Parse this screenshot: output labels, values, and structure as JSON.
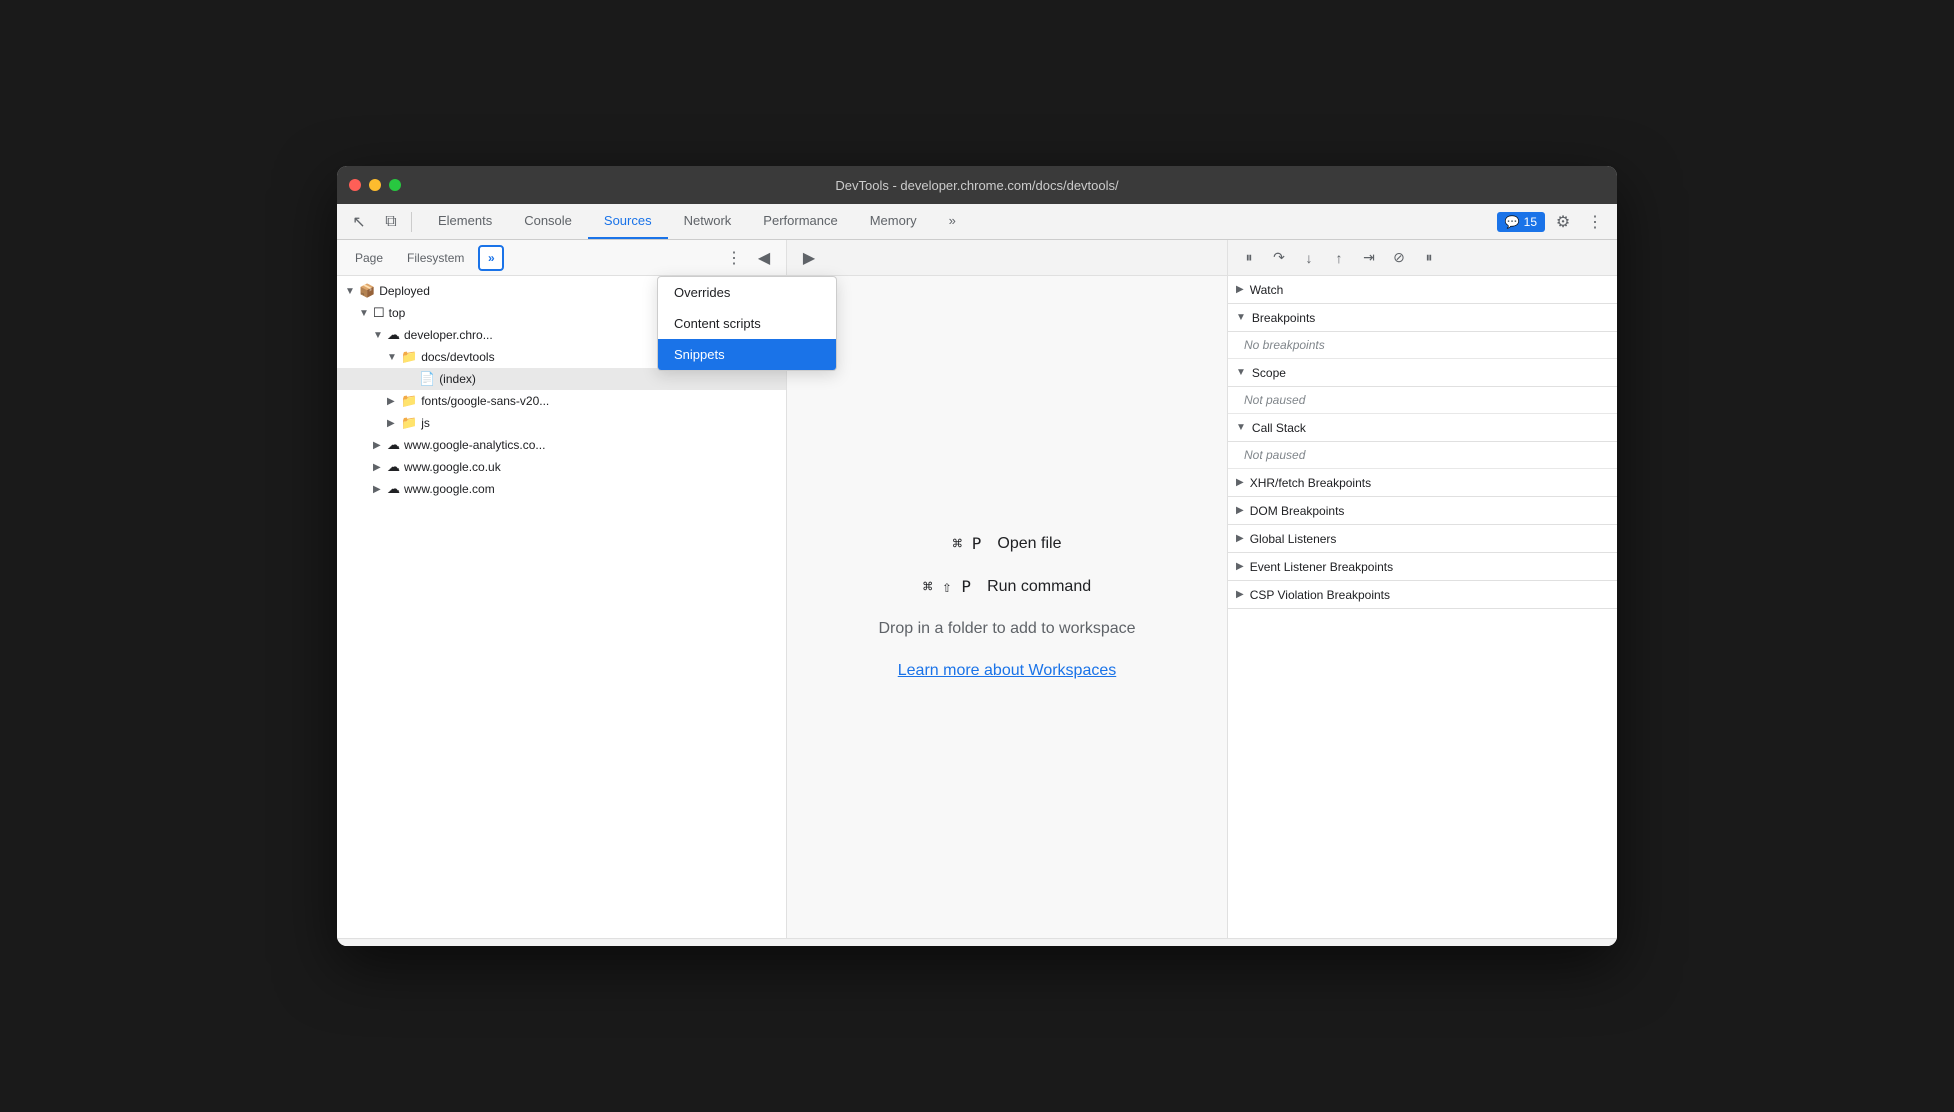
{
  "titlebar": {
    "title": "DevTools - developer.chrome.com/docs/devtools/"
  },
  "toolbar": {
    "tabs": [
      {
        "id": "elements",
        "label": "Elements",
        "active": false
      },
      {
        "id": "console",
        "label": "Console",
        "active": false
      },
      {
        "id": "sources",
        "label": "Sources",
        "active": true
      },
      {
        "id": "network",
        "label": "Network",
        "active": false
      },
      {
        "id": "performance",
        "label": "Performance",
        "active": false
      },
      {
        "id": "memory",
        "label": "Memory",
        "active": false
      }
    ],
    "badge": {
      "icon": "💬",
      "count": "15"
    },
    "more_tabs_label": "»"
  },
  "sources_panel": {
    "tabs": [
      {
        "id": "page",
        "label": "Page"
      },
      {
        "id": "filesystem",
        "label": "Filesystem"
      }
    ],
    "more_btn": "»",
    "file_tree": [
      {
        "level": 0,
        "indent": 0,
        "icon": "📦",
        "label": "Deployed",
        "expanded": true,
        "type": "folder"
      },
      {
        "level": 1,
        "indent": 1,
        "icon": "☐",
        "label": "top",
        "expanded": true,
        "type": "frame"
      },
      {
        "level": 2,
        "indent": 2,
        "icon": "☁",
        "label": "developer.chro...",
        "expanded": true,
        "type": "domain"
      },
      {
        "level": 3,
        "indent": 3,
        "icon": "📁",
        "label": "docs/devtools",
        "expanded": true,
        "type": "folder"
      },
      {
        "level": 4,
        "indent": 4,
        "icon": "📄",
        "label": "(index)",
        "selected": true,
        "type": "file"
      },
      {
        "level": 3,
        "indent": 2,
        "icon": "📁",
        "label": "fonts/google-sans-v20...",
        "expanded": false,
        "type": "folder"
      },
      {
        "level": 3,
        "indent": 2,
        "icon": "📁",
        "label": "js",
        "expanded": false,
        "type": "folder"
      },
      {
        "level": 2,
        "indent": 1,
        "icon": "☁",
        "label": "www.google-analytics.co...",
        "expanded": false,
        "type": "domain"
      },
      {
        "level": 2,
        "indent": 1,
        "icon": "☁",
        "label": "www.google.co.uk",
        "expanded": false,
        "type": "domain"
      },
      {
        "level": 2,
        "indent": 1,
        "icon": "☁",
        "label": "www.google.com",
        "expanded": false,
        "type": "domain"
      }
    ]
  },
  "center_panel": {
    "shortcuts": [
      {
        "keys": "⌘ P",
        "label": "Open file"
      },
      {
        "keys": "⌘ ⇧ P",
        "label": "Run command"
      }
    ],
    "workspace_hint": "Drop in a folder to add to workspace",
    "workspace_link": "Learn more about Workspaces"
  },
  "dropdown_menu": {
    "items": [
      {
        "id": "overrides",
        "label": "Overrides",
        "active": false
      },
      {
        "id": "content-scripts",
        "label": "Content scripts",
        "active": false
      },
      {
        "id": "snippets",
        "label": "Snippets",
        "active": true
      }
    ]
  },
  "right_panel": {
    "sections": [
      {
        "id": "watch",
        "label": "Watch",
        "expanded": false,
        "content": null
      },
      {
        "id": "breakpoints",
        "label": "Breakpoints",
        "expanded": true,
        "content": "No breakpoints"
      },
      {
        "id": "scope",
        "label": "Scope",
        "expanded": true,
        "content": "Not paused"
      },
      {
        "id": "call-stack",
        "label": "Call Stack",
        "expanded": true,
        "content": "Not paused"
      },
      {
        "id": "xhr-fetch",
        "label": "XHR/fetch Breakpoints",
        "expanded": false,
        "content": null
      },
      {
        "id": "dom-breakpoints",
        "label": "DOM Breakpoints",
        "expanded": false,
        "content": null
      },
      {
        "id": "global-listeners",
        "label": "Global Listeners",
        "expanded": false,
        "content": null
      },
      {
        "id": "event-listeners",
        "label": "Event Listener Breakpoints",
        "expanded": false,
        "content": null
      },
      {
        "id": "csp-violations",
        "label": "CSP Violation Breakpoints",
        "expanded": false,
        "content": null
      }
    ]
  },
  "icons": {
    "cursor": "↖",
    "layers": "⧉",
    "more_vert": "⋮",
    "settings": "⚙",
    "chevron_right": "»",
    "play": "▶",
    "pause": "⏸",
    "step_over": "↷",
    "step_into": "↓",
    "step_out": "↑",
    "continue": "⇥",
    "deactivate": "⊘",
    "collapse_left": "◀",
    "collapse_right": "▶"
  }
}
